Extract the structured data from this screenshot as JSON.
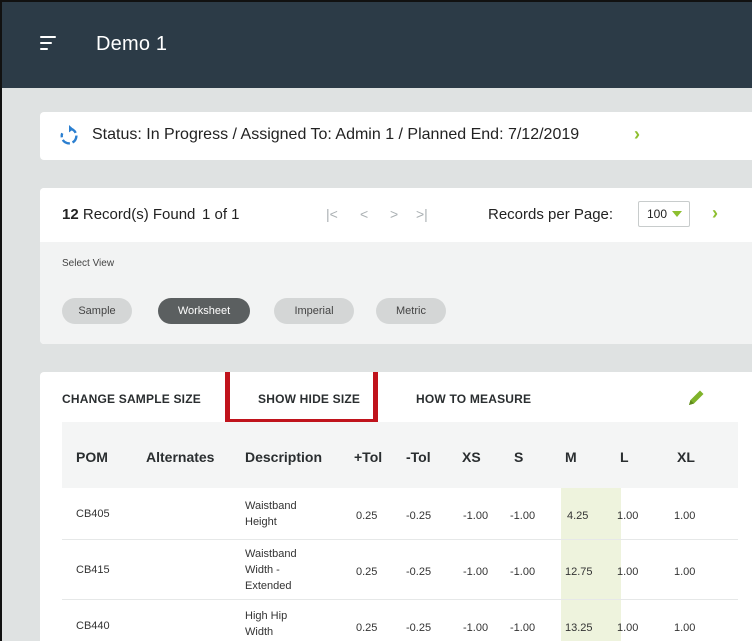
{
  "header": {
    "title": "Demo 1",
    "menu_icon": "hamburger-menu-icon"
  },
  "status": {
    "icon": "refresh-icon",
    "text": "Status: In Progress / Assigned To: Admin 1 / Planned End: 7/12/2019",
    "chevron": "›"
  },
  "records": {
    "count": "12",
    "count_suffix": " Record(s) Found",
    "page": "1 of 1",
    "first": "|<",
    "prev": "<",
    "next": ">",
    "last": ">|",
    "per_page_label": "Records per Page:",
    "per_page_value": "100",
    "chevron": "›"
  },
  "view": {
    "label": "Select View",
    "options": [
      "Sample",
      "Worksheet",
      "Imperial",
      "Metric"
    ],
    "selected": "Worksheet"
  },
  "actions": {
    "change_sample_size": "CHANGE SAMPLE SIZE",
    "show_hide_size": "SHOW HIDE SIZE",
    "how_to_measure": "HOW TO MEASURE",
    "edit_icon": "pencil-icon"
  },
  "table": {
    "headers": [
      "POM",
      "Alternates",
      "Description",
      "+Tol",
      "-Tol",
      "XS",
      "S",
      "M",
      "L",
      "XL"
    ],
    "rows": [
      {
        "pom": "CB405",
        "alternates": "",
        "description": [
          "Waistband",
          "Height"
        ],
        "plus_tol": "0.25",
        "minus_tol": "-0.25",
        "xs": "-1.00",
        "s": "-1.00",
        "m": "4.25",
        "l": "1.00",
        "xl": "1.00"
      },
      {
        "pom": "CB415",
        "alternates": "",
        "description": [
          "Waistband",
          "Width -",
          "Extended"
        ],
        "plus_tol": "0.25",
        "minus_tol": "-0.25",
        "xs": "-1.00",
        "s": "-1.00",
        "m": "12.75",
        "l": "1.00",
        "xl": "1.00"
      },
      {
        "pom": "CB440",
        "alternates": "",
        "description": [
          "High Hip",
          "Width"
        ],
        "plus_tol": "0.25",
        "minus_tol": "-0.25",
        "xs": "-1.00",
        "s": "-1.00",
        "m": "13.25",
        "l": "1.00",
        "xl": "1.00"
      }
    ]
  },
  "colors": {
    "topbar": "#2c3b47",
    "accent": "#8dbf2f",
    "highlight": "#c0131c",
    "m_column": "#eef3dd"
  }
}
